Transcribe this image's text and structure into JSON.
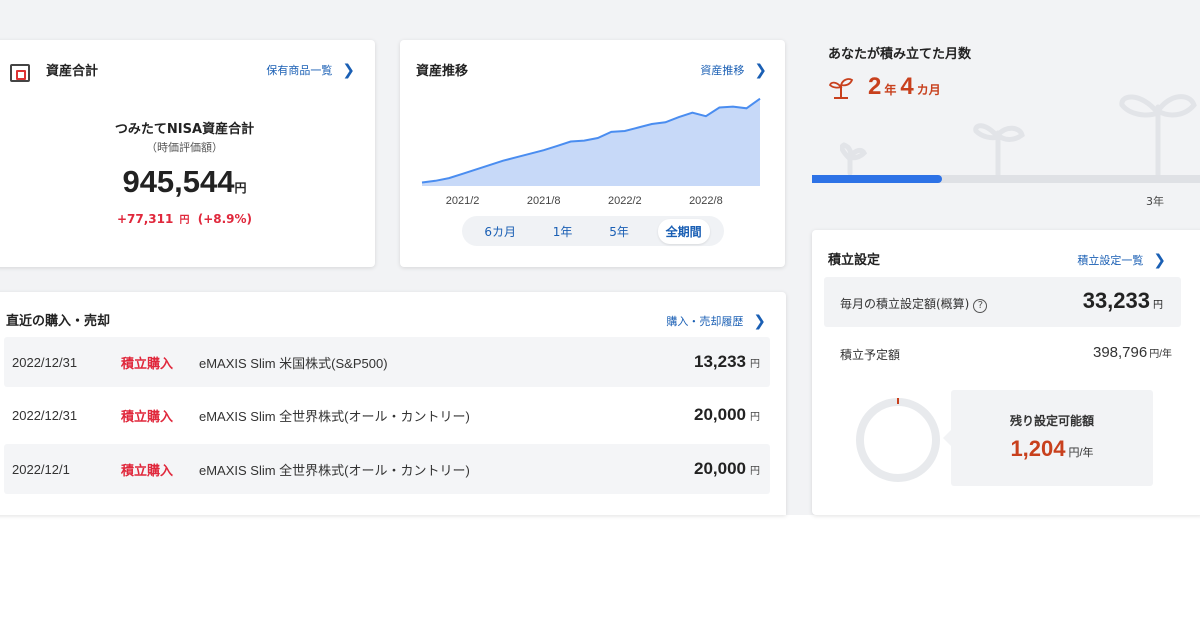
{
  "asset_summary": {
    "title": "資産合計",
    "link_label": "保有商品一覧",
    "nisa_title": "つみたてNISA資産合計",
    "nisa_subtitle": "（時価評価額）",
    "total_value": "945,544",
    "currency": "円",
    "change_amount": "+77,311",
    "change_unit": "円",
    "change_percent": "(+8.9%)",
    "change_color": "#e0283c"
  },
  "asset_trend": {
    "title": "資産推移",
    "link_label": "資産推移",
    "ranges": [
      {
        "label": "6カ月",
        "active": false
      },
      {
        "label": "1年",
        "active": false
      },
      {
        "label": "5年",
        "active": false
      },
      {
        "label": "全期間",
        "active": true
      }
    ]
  },
  "chart_data": {
    "type": "area",
    "x": [
      "2020/11",
      "2020/12",
      "2021/1",
      "2021/2",
      "2021/3",
      "2021/4",
      "2021/5",
      "2021/6",
      "2021/7",
      "2021/8",
      "2021/9",
      "2021/10",
      "2021/11",
      "2021/12",
      "2022/1",
      "2022/2",
      "2022/3",
      "2022/4",
      "2022/5",
      "2022/6",
      "2022/7",
      "2022/8",
      "2022/9",
      "2022/10",
      "2022/11",
      "2022/12"
    ],
    "values": [
      4,
      6,
      9,
      14,
      19,
      24,
      29,
      33,
      37,
      41,
      46,
      51,
      52,
      55,
      62,
      63,
      67,
      71,
      73,
      79,
      84,
      80,
      90,
      91,
      89,
      100
    ],
    "tick_labels": [
      "2021/2",
      "2021/8",
      "2022/2",
      "2022/8"
    ],
    "tick_indices": [
      3,
      9,
      15,
      21
    ],
    "ylim": [
      0,
      110
    ],
    "line_color": "#4a8df0",
    "fill_color": "#c7d9f8"
  },
  "transactions": {
    "title": "直近の購入・売却",
    "link_label": "購入・売却履歴",
    "rows": [
      {
        "date": "2022/12/31",
        "type": "積立購入",
        "fund": "eMAXIS Slim 米国株式(S&P500)",
        "amount": "13,233",
        "unit": "円"
      },
      {
        "date": "2022/12/31",
        "type": "積立購入",
        "fund": "eMAXIS Slim 全世界株式(オール・カントリー)",
        "amount": "20,000",
        "unit": "円"
      },
      {
        "date": "2022/12/1",
        "type": "積立購入",
        "fund": "eMAXIS Slim 全世界株式(オール・カントリー)",
        "amount": "20,000",
        "unit": "円"
      }
    ]
  },
  "months": {
    "title": "あなたが積み立てた月数",
    "years": "2",
    "years_unit": "年",
    "months": "4",
    "months_unit": "カ月",
    "progress_fraction": 0.335,
    "goal_label": "3年",
    "accent_color": "#c8401d",
    "progress_color": "#2d72e6"
  },
  "settings": {
    "title": "積立設定",
    "link_label": "積立設定一覧",
    "monthly_label": "毎月の積立設定額(概算)",
    "help_glyph": "?",
    "monthly_value": "33,233",
    "monthly_unit": "円",
    "plan_label": "積立予定額",
    "plan_value": "398,796",
    "plan_unit": "円/年",
    "remain_label": "残り設定可能額",
    "remain_value": "1,204",
    "remain_unit": "円/年"
  }
}
